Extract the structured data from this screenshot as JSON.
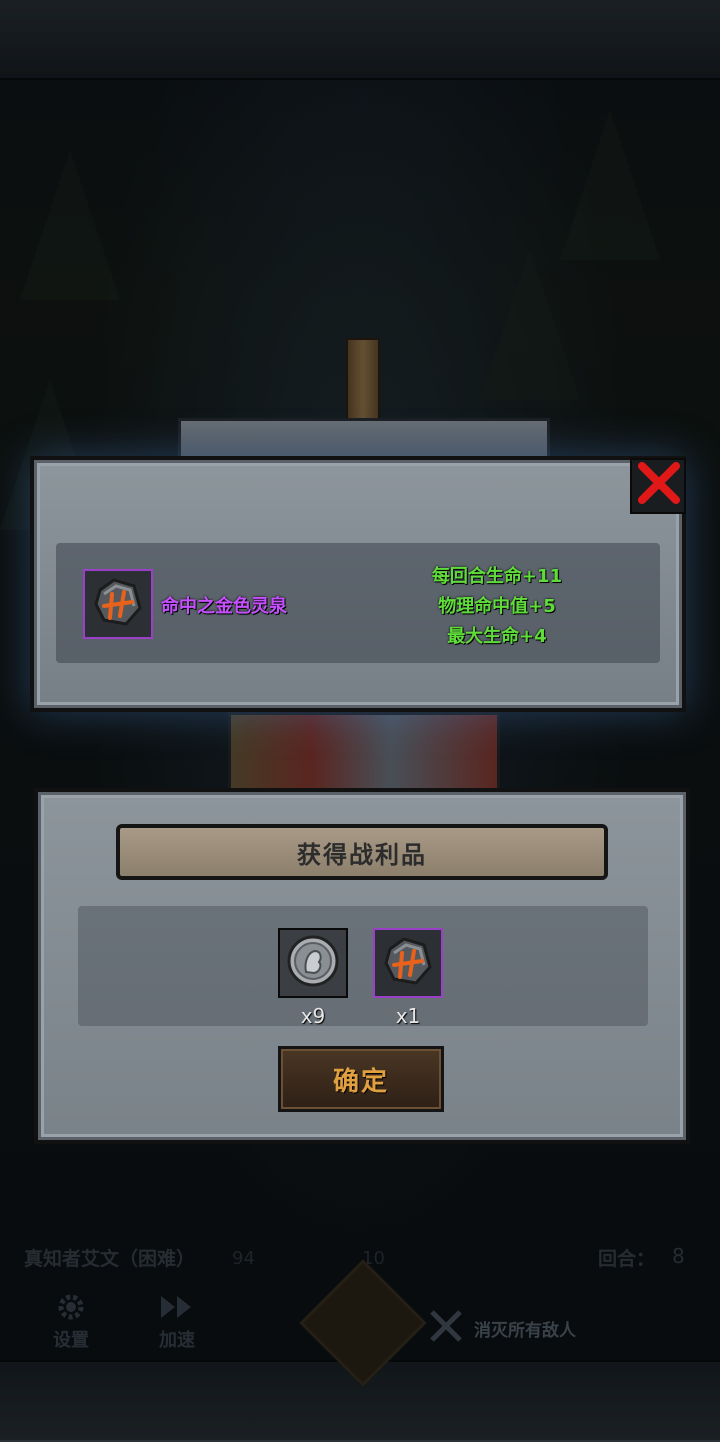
{
  "item_detail": {
    "item_name": "命中之金色灵泉",
    "item_icon": "rune-stone-icon",
    "stats": [
      "每回合生命+11",
      "物理命中值+5",
      "最大生命+4"
    ],
    "close_icon": "close-x-icon",
    "colors": {
      "item_name": "#c64fff",
      "stats": "#5fdc3a",
      "close": "#e01818",
      "rarity_border": "#9a3fc8"
    }
  },
  "loot": {
    "title": "获得战利品",
    "items": [
      {
        "icon": "silver-coin-icon",
        "quantity": "x9"
      },
      {
        "icon": "rune-stone-icon",
        "quantity": "x1"
      }
    ],
    "confirm_label": "确定"
  },
  "hud": {
    "stage_name": "真知者艾文（困难）",
    "hp_left": "94",
    "hp_right": "10",
    "round_label": "回合：",
    "round_value": "8",
    "settings_label": "设置",
    "speed_label": "加速",
    "objective": "消灭所有敌人"
  }
}
